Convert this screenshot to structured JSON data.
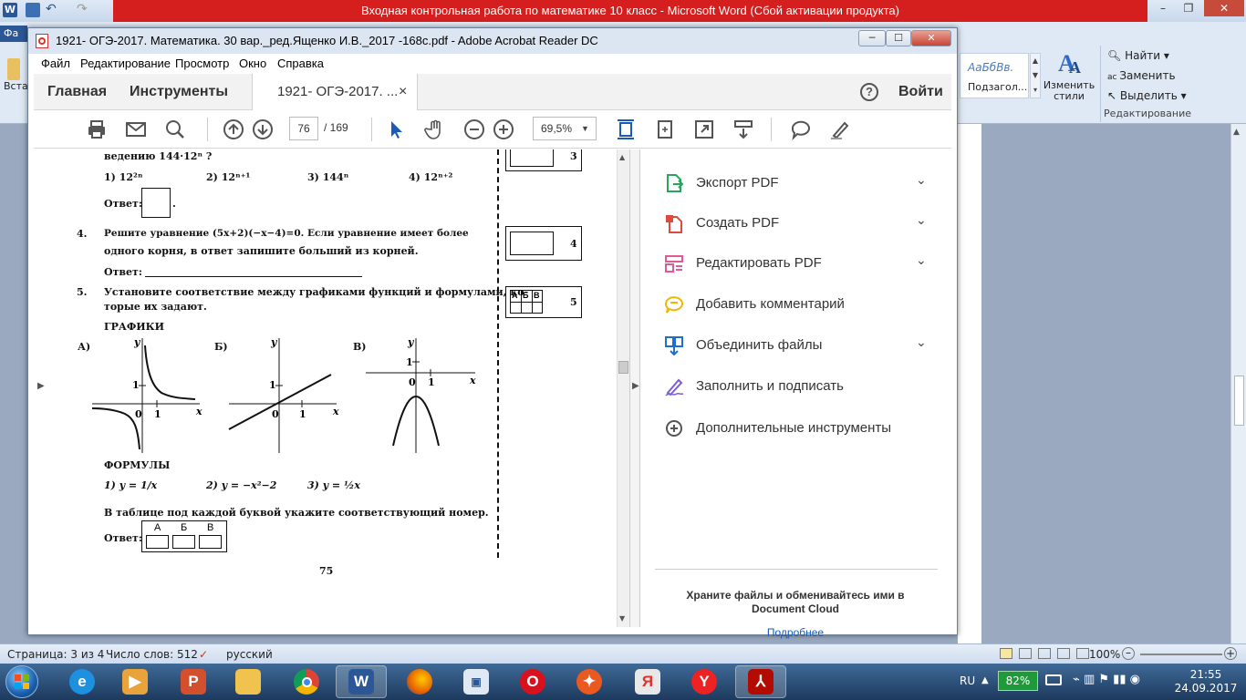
{
  "word": {
    "title": "Входная контрольная работа по математике 10 класс  -  Microsoft Word (Сбой активации продукта)",
    "file_tab": "Фа",
    "ribbon": {
      "style_preview": "АаБбВв.",
      "style_name": "Подзагол...",
      "change_styles": "Изменить стили",
      "find": "Найти",
      "replace": "Заменить",
      "select": "Выделить",
      "group_editing": "Редактирование",
      "partial_left": "Вста"
    },
    "status": {
      "page": "Страница: 3 из 4",
      "words": "Число слов: 512",
      "language": "русский",
      "zoom": "100%"
    }
  },
  "acrobat": {
    "title": "1921- ОГЭ-2017. Математика. 30 вар._ред.Ященко И.В._2017 -168с.pdf - Adobe Acrobat Reader DC",
    "menu": [
      "Файл",
      "Редактирование",
      "Просмотр",
      "Окно",
      "Справка"
    ],
    "tabs": {
      "home": "Главная",
      "tools": "Инструменты",
      "doc": "1921- ОГЭ-2017. ...",
      "close": "×",
      "help": "?",
      "signin": "Войти"
    },
    "toolbar": {
      "page_current": "76",
      "page_total": "/  169",
      "zoom": "69,5%"
    },
    "tools": [
      {
        "label": "Экспорт PDF",
        "icon": "export-pdf-icon",
        "color": "#26a65b",
        "expandable": true
      },
      {
        "label": "Создать PDF",
        "icon": "create-pdf-icon",
        "color": "#e0493e",
        "expandable": true
      },
      {
        "label": "Редактировать PDF",
        "icon": "edit-pdf-icon",
        "color": "#e05a9b",
        "expandable": true
      },
      {
        "label": "Добавить комментарий",
        "icon": "comment-icon",
        "color": "#f0b800",
        "expandable": false
      },
      {
        "label": "Объединить файлы",
        "icon": "combine-files-icon",
        "color": "#1f6fd1",
        "expandable": true
      },
      {
        "label": "Заполнить и подписать",
        "icon": "fill-sign-icon",
        "color": "#7b5ed8",
        "expandable": false
      },
      {
        "label": "Дополнительные инструменты",
        "icon": "more-tools-icon",
        "color": "#555555",
        "expandable": false
      }
    ],
    "cloud": {
      "text": "Храните файлы и обменивайтесь ими в Document Cloud",
      "link": "Подробнее"
    }
  },
  "pdf": {
    "q3_tail": "ведению 144·12ⁿ ?",
    "q3_options": [
      "1)  12²ⁿ",
      "2)  12ⁿ⁺¹",
      "3)  144ⁿ",
      "4)  12ⁿ⁺²"
    ],
    "answer_label": "Ответ:",
    "q4_num": "4.",
    "q4_line1": "Решите  уравнение   (5x+2)(−x−4)=0.  Если  уравнение  имеет  более",
    "q4_line2": "одного корня, в ответ запишите больший из корней.",
    "q5_num": "5.",
    "q5_line1": "Установите соответствие между графиками функций и формулами, ко-",
    "q5_line2": "торые их задают.",
    "graphs_heading": "ГРАФИКИ",
    "graph_labels": [
      "А)",
      "Б)",
      "В)"
    ],
    "axis_y": "y",
    "axis_x": "x",
    "tick_zero": "0",
    "tick_one": "1",
    "formulas_heading": "ФОРМУЛЫ",
    "formula_1": "1)  y = 1/x",
    "formula_2": "2)  y = −x²−2",
    "formula_3": "3)  y = ½x",
    "instruction": "В таблице под каждой буквой укажите соответствующий номер.",
    "table_letters": [
      "А",
      "Б",
      "В"
    ],
    "side_box_nums": [
      "3",
      "4",
      "5"
    ],
    "page_number": "75"
  },
  "taskbar": {
    "lang": "RU",
    "battery": "82%",
    "time": "21:55",
    "date": "24.09.2017"
  }
}
